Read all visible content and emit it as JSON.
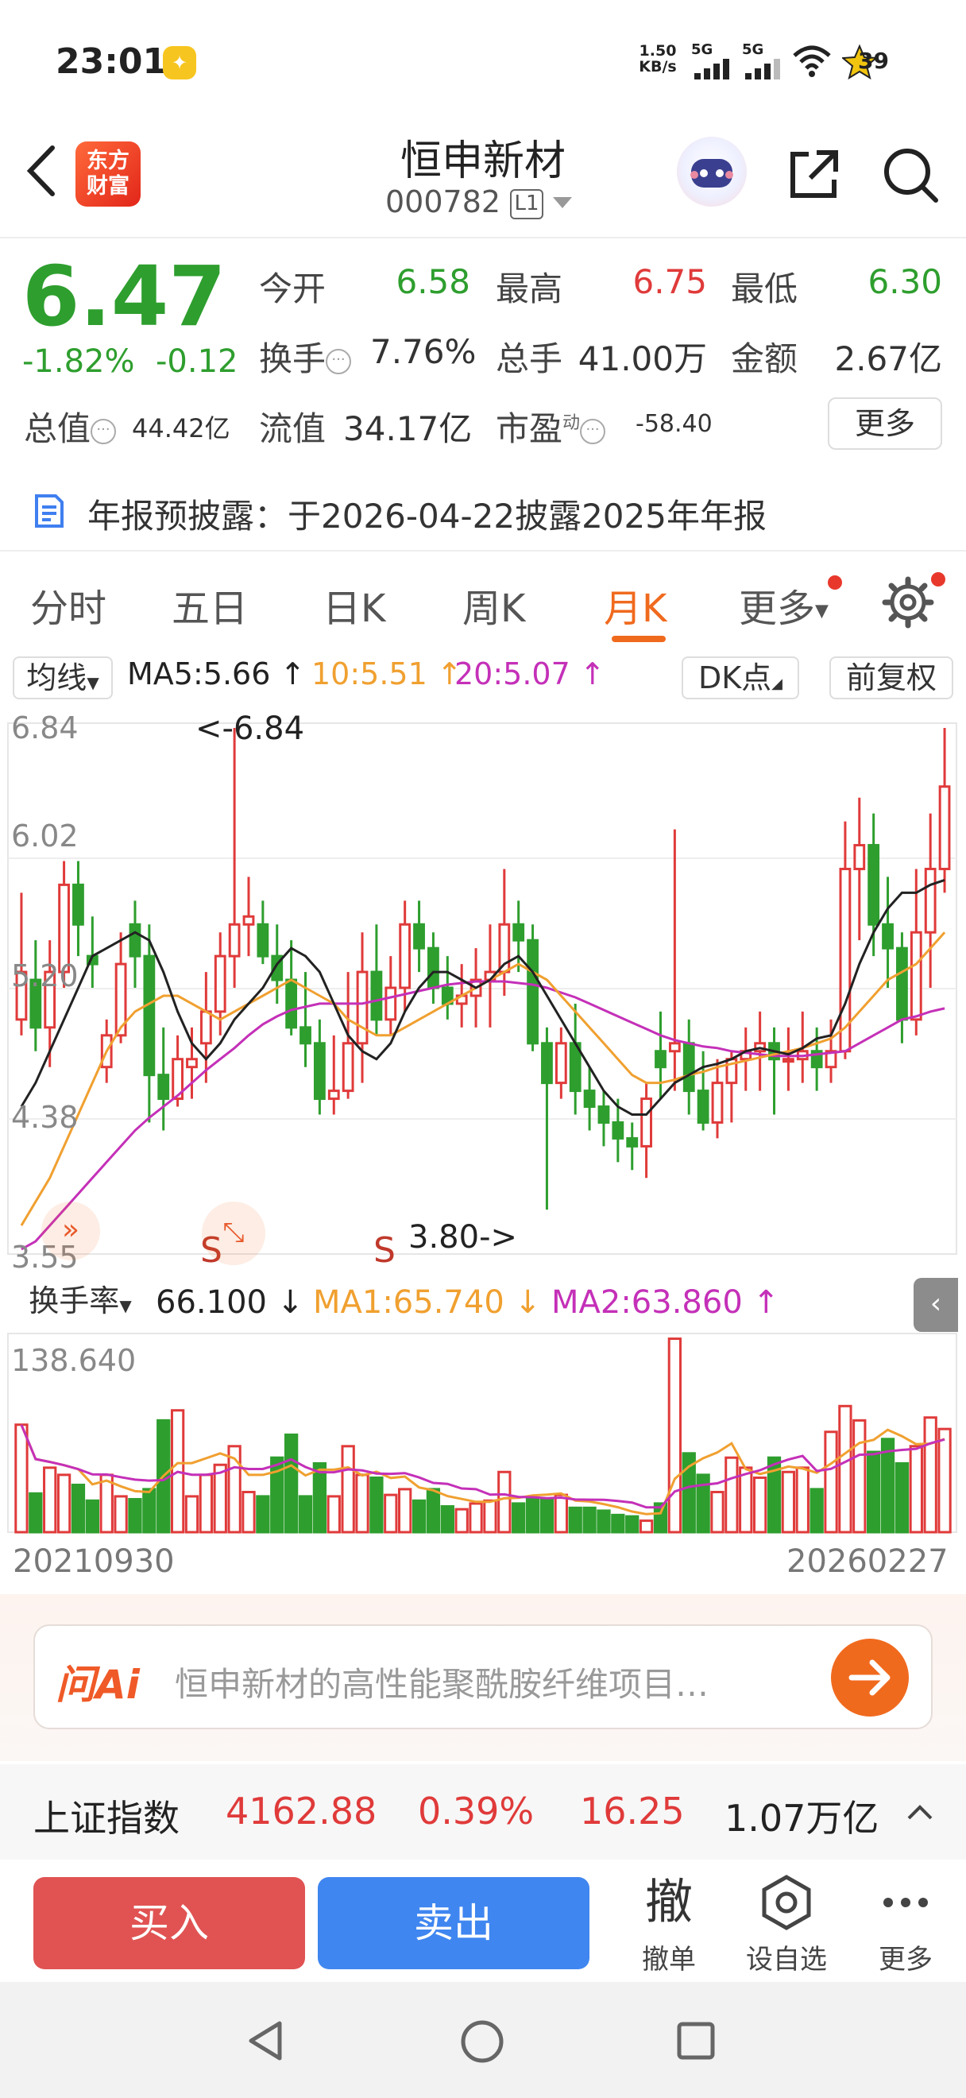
{
  "status_bar": {
    "time": "23:01",
    "speed": "1.50",
    "speed_unit": "KB/s",
    "network1": "5G",
    "network2": "5G",
    "battery": "39",
    "icons": [
      "app-notification-icon",
      "signal-icon",
      "signal-icon",
      "wifi-icon",
      "battery-icon"
    ]
  },
  "header": {
    "logo_line1": "东方",
    "logo_line2": "财富",
    "stock_name": "恒申新材",
    "stock_code": "000782",
    "level_badge": "L1"
  },
  "quote": {
    "price": "6.47",
    "pct_change": "-1.82%",
    "abs_change": "-0.12",
    "open_label": "今开",
    "open": "6.58",
    "high_label": "最高",
    "high": "6.75",
    "low_label": "最低",
    "low": "6.30",
    "turnover_label": "换手",
    "turnover": "7.76%",
    "volume_label": "总手",
    "volume": "41.00万",
    "amount_label": "金额",
    "amount": "2.67亿",
    "market_cap_label": "总值",
    "market_cap": "44.42亿",
    "float_cap_label": "流值",
    "float_cap": "34.17亿",
    "pe_label": "市盈",
    "pe_sup": "动",
    "pe": "-58.40",
    "more_label": "更多"
  },
  "notice": {
    "text": "年报预披露：于2026-04-22披露2025年年报"
  },
  "tabs": {
    "items": [
      "分时",
      "五日",
      "日K",
      "周K",
      "月K",
      "更多"
    ],
    "active": "月K"
  },
  "ma_bar": {
    "selector_label": "均线",
    "ma5": "MA5:5.66 ↑",
    "ma10": "10:5.51 ↑",
    "ma20": "20:5.07 ↑",
    "dk_label": "DK点",
    "adjust_label": "前复权"
  },
  "colors": {
    "up": "#e03a3a",
    "down": "#2e9e2e",
    "ma5": "#222222",
    "ma10": "#f0a030",
    "ma20": "#c430b8",
    "accent": "#f06a1e"
  },
  "chart_data": [
    {
      "type": "candlestick",
      "period": "monthly",
      "y_ticks": [
        "6.84",
        "6.02",
        "5.20",
        "4.38",
        "3.55"
      ],
      "ylim": [
        3.55,
        6.84
      ],
      "annotations": {
        "max_label": "<-6.84",
        "min_label": "3.80->",
        "signal_marks": [
          "S",
          "S"
        ]
      },
      "x_start": "20210930",
      "x_end": "20260227",
      "candles": [
        [
          5.0,
          5.3,
          4.9,
          5.8
        ],
        [
          5.25,
          4.95,
          4.8,
          5.5
        ],
        [
          4.95,
          5.3,
          4.7,
          5.5
        ],
        [
          5.3,
          5.85,
          5.2,
          6.0
        ],
        [
          5.85,
          5.6,
          5.4,
          6.0
        ],
        [
          5.4,
          5.35,
          5.2,
          5.65
        ],
        [
          4.7,
          4.9,
          4.6,
          5.0
        ],
        [
          4.9,
          5.35,
          4.85,
          5.55
        ],
        [
          5.6,
          5.4,
          5.2,
          5.75
        ],
        [
          5.4,
          4.65,
          4.35,
          5.6
        ],
        [
          4.65,
          4.5,
          4.3,
          4.95
        ],
        [
          4.5,
          4.75,
          4.45,
          4.9
        ],
        [
          4.7,
          4.75,
          4.5,
          4.95
        ],
        [
          4.85,
          5.05,
          4.6,
          5.3
        ],
        [
          5.05,
          5.4,
          4.9,
          5.55
        ],
        [
          5.4,
          5.6,
          5.2,
          6.84
        ],
        [
          5.6,
          5.65,
          5.4,
          5.9
        ],
        [
          5.6,
          5.4,
          5.35,
          5.75
        ],
        [
          5.4,
          5.25,
          5.1,
          5.6
        ],
        [
          5.25,
          4.95,
          4.9,
          5.5
        ],
        [
          4.95,
          4.85,
          4.7,
          5.3
        ],
        [
          4.85,
          4.5,
          4.4,
          5.0
        ],
        [
          4.5,
          4.55,
          4.4,
          4.9
        ],
        [
          4.55,
          4.85,
          4.5,
          5.3
        ],
        [
          4.85,
          5.3,
          4.6,
          5.55
        ],
        [
          5.3,
          5.0,
          4.9,
          5.6
        ],
        [
          5.0,
          5.2,
          4.9,
          5.4
        ],
        [
          5.2,
          5.6,
          5.05,
          5.75
        ],
        [
          5.6,
          5.45,
          5.3,
          5.75
        ],
        [
          5.45,
          5.2,
          5.1,
          5.55
        ],
        [
          5.2,
          5.1,
          5.0,
          5.4
        ],
        [
          5.1,
          5.15,
          4.95,
          5.35
        ],
        [
          5.15,
          5.25,
          4.95,
          5.45
        ],
        [
          5.25,
          5.3,
          4.95,
          5.6
        ],
        [
          5.3,
          5.6,
          5.15,
          5.95
        ],
        [
          5.6,
          5.5,
          5.3,
          5.75
        ],
        [
          5.5,
          4.85,
          4.8,
          5.6
        ],
        [
          4.85,
          4.6,
          3.8,
          4.95
        ],
        [
          4.6,
          4.85,
          4.5,
          4.95
        ],
        [
          4.85,
          4.55,
          4.4,
          5.1
        ],
        [
          4.55,
          4.45,
          4.3,
          4.7
        ],
        [
          4.45,
          4.35,
          4.2,
          4.55
        ],
        [
          4.35,
          4.25,
          4.1,
          4.5
        ],
        [
          4.25,
          4.2,
          4.05,
          4.35
        ],
        [
          4.2,
          4.5,
          4.0,
          4.6
        ],
        [
          4.8,
          4.7,
          4.5,
          5.05
        ],
        [
          4.8,
          4.85,
          4.55,
          6.2
        ],
        [
          4.85,
          4.55,
          4.4,
          5.0
        ],
        [
          4.55,
          4.35,
          4.3,
          4.8
        ],
        [
          4.35,
          4.6,
          4.25,
          4.75
        ],
        [
          4.6,
          4.75,
          4.35,
          4.8
        ],
        [
          4.75,
          4.8,
          4.55,
          4.95
        ],
        [
          4.8,
          4.85,
          4.55,
          5.05
        ],
        [
          4.85,
          4.75,
          4.4,
          4.95
        ],
        [
          4.75,
          4.75,
          4.55,
          4.95
        ],
        [
          4.75,
          4.8,
          4.6,
          5.05
        ],
        [
          4.8,
          4.7,
          4.55,
          4.95
        ],
        [
          4.7,
          4.8,
          4.6,
          5.0
        ],
        [
          4.8,
          5.95,
          4.75,
          6.25
        ],
        [
          5.95,
          6.1,
          5.5,
          6.4
        ],
        [
          6.1,
          5.6,
          5.4,
          6.3
        ],
        [
          5.6,
          5.45,
          5.2,
          5.9
        ],
        [
          5.45,
          5.0,
          4.85,
          5.55
        ],
        [
          5.0,
          5.55,
          4.9,
          5.95
        ],
        [
          5.55,
          5.95,
          5.2,
          6.3
        ],
        [
          5.95,
          6.47,
          5.8,
          6.84
        ]
      ],
      "ma5": [
        4.45,
        4.6,
        4.8,
        5.0,
        5.2,
        5.4,
        5.45,
        5.5,
        5.55,
        5.5,
        5.3,
        5.05,
        4.85,
        4.75,
        4.85,
        5.0,
        5.1,
        5.2,
        5.35,
        5.45,
        5.4,
        5.3,
        5.1,
        4.9,
        4.8,
        4.75,
        4.85,
        5.05,
        5.2,
        5.3,
        5.3,
        5.25,
        5.2,
        5.25,
        5.35,
        5.4,
        5.3,
        5.15,
        5.0,
        4.85,
        4.7,
        4.55,
        4.45,
        4.4,
        4.4,
        4.5,
        4.6,
        4.65,
        4.7,
        4.72,
        4.75,
        4.8,
        4.82,
        4.8,
        4.78,
        4.82,
        4.88,
        4.9,
        5.1,
        5.35,
        5.55,
        5.7,
        5.8,
        5.8,
        5.85,
        5.88
      ],
      "ma10": [
        3.7,
        3.85,
        4.0,
        4.2,
        4.4,
        4.6,
        4.8,
        4.95,
        5.05,
        5.1,
        5.15,
        5.15,
        5.1,
        5.05,
        5.0,
        5.05,
        5.1,
        5.15,
        5.2,
        5.25,
        5.2,
        5.15,
        5.1,
        5.0,
        4.95,
        4.9,
        4.9,
        4.95,
        5.0,
        5.05,
        5.1,
        5.15,
        5.2,
        5.25,
        5.3,
        5.35,
        5.3,
        5.25,
        5.15,
        5.05,
        4.95,
        4.85,
        4.75,
        4.65,
        4.6,
        4.6,
        4.62,
        4.65,
        4.67,
        4.7,
        4.72,
        4.74,
        4.76,
        4.78,
        4.8,
        4.82,
        4.85,
        4.88,
        4.95,
        5.05,
        5.15,
        5.25,
        5.3,
        5.35,
        5.45,
        5.55
      ],
      "ma20": [
        3.55,
        3.6,
        3.7,
        3.8,
        3.9,
        4.0,
        4.1,
        4.2,
        4.3,
        4.38,
        4.45,
        4.52,
        4.6,
        4.68,
        4.75,
        4.82,
        4.9,
        4.97,
        5.02,
        5.06,
        5.08,
        5.1,
        5.1,
        5.1,
        5.1,
        5.12,
        5.14,
        5.16,
        5.18,
        5.2,
        5.22,
        5.23,
        5.24,
        5.24,
        5.24,
        5.23,
        5.22,
        5.2,
        5.17,
        5.14,
        5.1,
        5.06,
        5.02,
        4.98,
        4.94,
        4.9,
        4.87,
        4.85,
        4.83,
        4.82,
        4.8,
        4.79,
        4.78,
        4.77,
        4.77,
        4.77,
        4.78,
        4.79,
        4.8,
        4.85,
        4.9,
        4.95,
        5.0,
        5.02,
        5.05,
        5.07
      ]
    },
    {
      "type": "bar",
      "title": "换手率",
      "selector_label": "换手率",
      "value_label": "66.100 ↓",
      "ma1": "MA1:65.740 ↓",
      "ma2": "MA2:63.860 ↑",
      "y_max_label": "138.640",
      "ylim": [
        0,
        138.64
      ],
      "x_start": "20210930",
      "x_end": "20260227",
      "values": [
        75,
        27,
        45,
        40,
        33,
        22,
        40,
        25,
        23,
        30,
        78,
        85,
        25,
        40,
        47,
        60,
        28,
        25,
        52,
        68,
        25,
        48,
        25,
        60,
        40,
        38,
        26,
        30,
        22,
        30,
        18,
        16,
        20,
        22,
        42,
        20,
        24,
        23,
        26,
        17,
        17,
        15,
        12,
        11,
        8,
        20,
        135,
        55,
        40,
        28,
        52,
        45,
        38,
        52,
        42,
        45,
        30,
        70,
        88,
        78,
        56,
        65,
        48,
        60,
        80,
        72
      ]
    }
  ],
  "ai_ask": {
    "logo": "问Ai",
    "question": "恒申新材的高性能聚酰胺纤维项目…"
  },
  "index_bar": {
    "name": "上证指数",
    "value": "4162.88",
    "pct": "0.39%",
    "change": "16.25",
    "amount": "1.07万亿"
  },
  "actions": {
    "buy": "买入",
    "sell": "卖出",
    "cancel_glyph": "撤",
    "cancel": "撤单",
    "watchlist": "设自选",
    "more": "更多"
  }
}
